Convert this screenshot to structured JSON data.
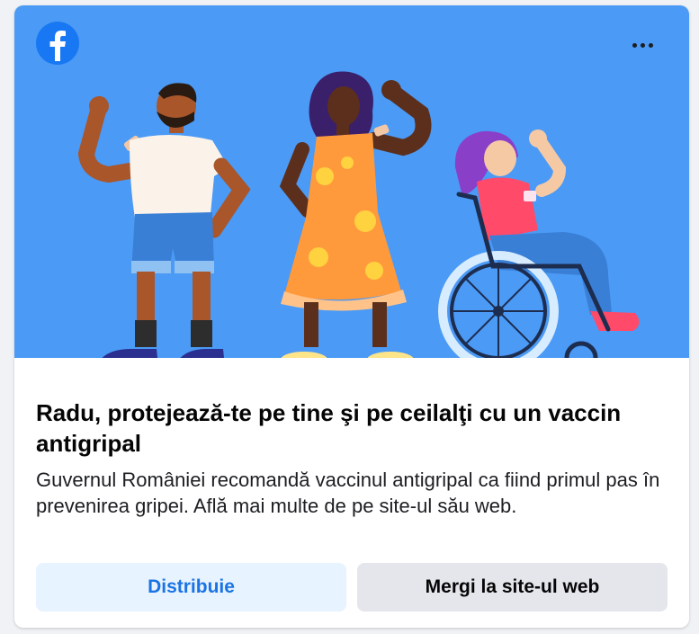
{
  "brand": {
    "logo_icon": "facebook-logo-icon",
    "logo_color": "#1877f2",
    "logo_letter": "f"
  },
  "menu": {
    "icon": "more-options-icon"
  },
  "hero": {
    "background": "#4b9af5",
    "illustration": "three-people-flexing-vaccinated-arms"
  },
  "ad": {
    "title": "Radu, protejează-te pe tine şi pe ceilalţi cu un vaccin antigripal",
    "body": "Guvernul României recomandă vaccinul antigripal ca fiind primul pas în prevenirea gripei. Află mai multe de pe site-ul său web."
  },
  "actions": {
    "share_label": "Distribuie",
    "website_label": "Mergi la site-ul web"
  }
}
